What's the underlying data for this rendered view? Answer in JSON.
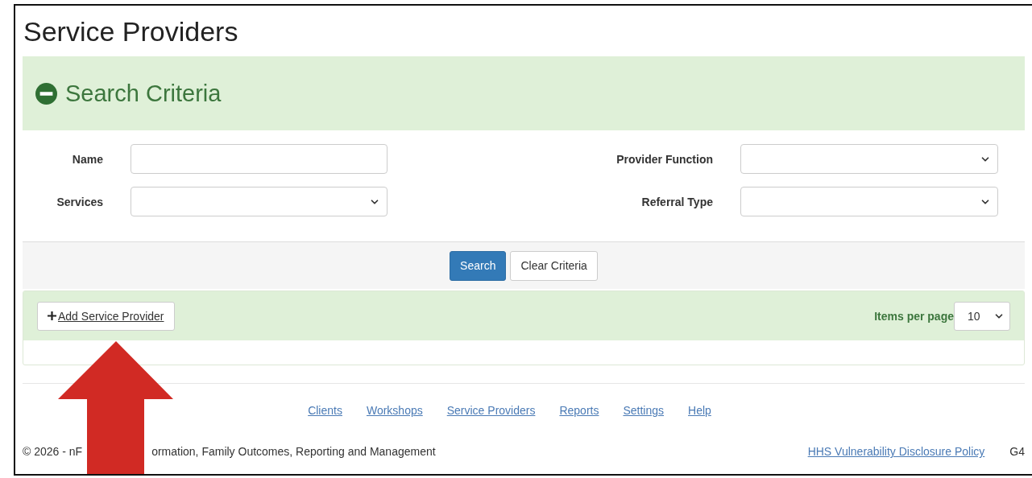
{
  "page": {
    "title": "Service Providers"
  },
  "search_panel": {
    "title": "Search Criteria",
    "expanded": true,
    "fields": [
      {
        "kind": "text",
        "label": "Name"
      },
      {
        "kind": "select",
        "label": "Provider Function"
      },
      {
        "kind": "select",
        "label": "Services"
      },
      {
        "kind": "select",
        "label": "Referral Type"
      }
    ],
    "buttons": [
      {
        "label": "Search",
        "primary": true
      },
      {
        "label": "Clear Criteria",
        "primary": false
      }
    ]
  },
  "results_bar": {
    "add_button": "Add Service Provider",
    "items_per_page_label": "Items per page",
    "items_per_page": "10"
  },
  "footer": {
    "links": [
      "Clients",
      "Workshops",
      "Service Providers",
      "Reports",
      "Settings",
      "Help"
    ],
    "copyright_parts": [
      "© 2026 - nF",
      "ormation, Family Outcomes, Reporting and Management"
    ],
    "policy_link": "HHS Vulnerability Disclosure Policy",
    "version": "G4"
  }
}
